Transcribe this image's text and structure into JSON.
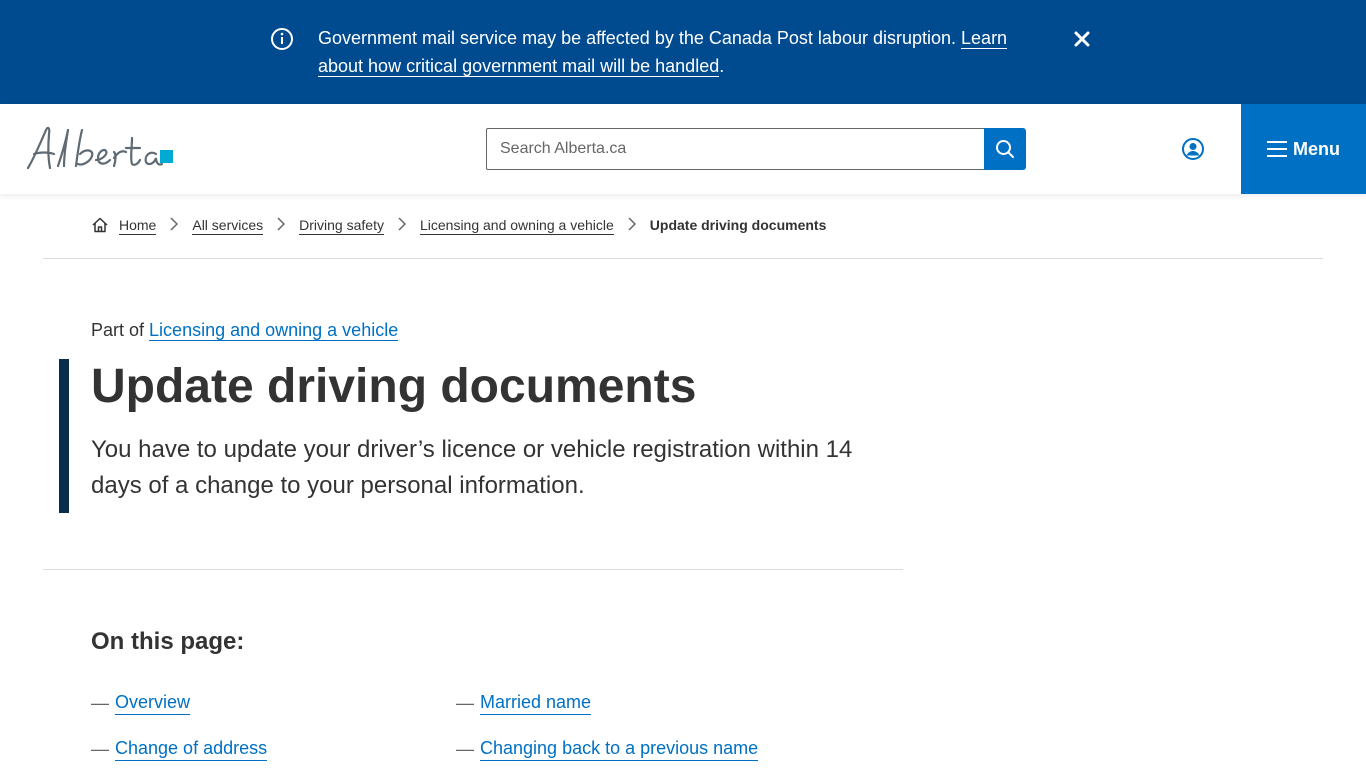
{
  "alert": {
    "message": "Government mail service may be affected by the Canada Post labour disruption.",
    "link_text": "Learn about how critical government mail will be handled",
    "suffix": "."
  },
  "header": {
    "logo_alt": "Alberta",
    "search_placeholder": "Search Alberta.ca",
    "menu_label": "Menu"
  },
  "breadcrumb": {
    "items": [
      "Home",
      "All services",
      "Driving safety",
      "Licensing and owning a vehicle"
    ],
    "current": "Update driving documents"
  },
  "hero": {
    "part_of_prefix": "Part of",
    "part_of_link": "Licensing and owning a vehicle",
    "title": "Update driving documents",
    "lead": "You have to update your driver’s licence or vehicle registration within 14 days of a change to your personal information."
  },
  "on_this_page": {
    "title": "On this page:",
    "dash": "—",
    "links": [
      "Overview",
      "Change of address",
      "Married name",
      "Changing back to a previous name"
    ]
  },
  "colors": {
    "banner": "#004a8f",
    "primary": "#0070c4",
    "hero_bar": "#0a2d4d"
  }
}
